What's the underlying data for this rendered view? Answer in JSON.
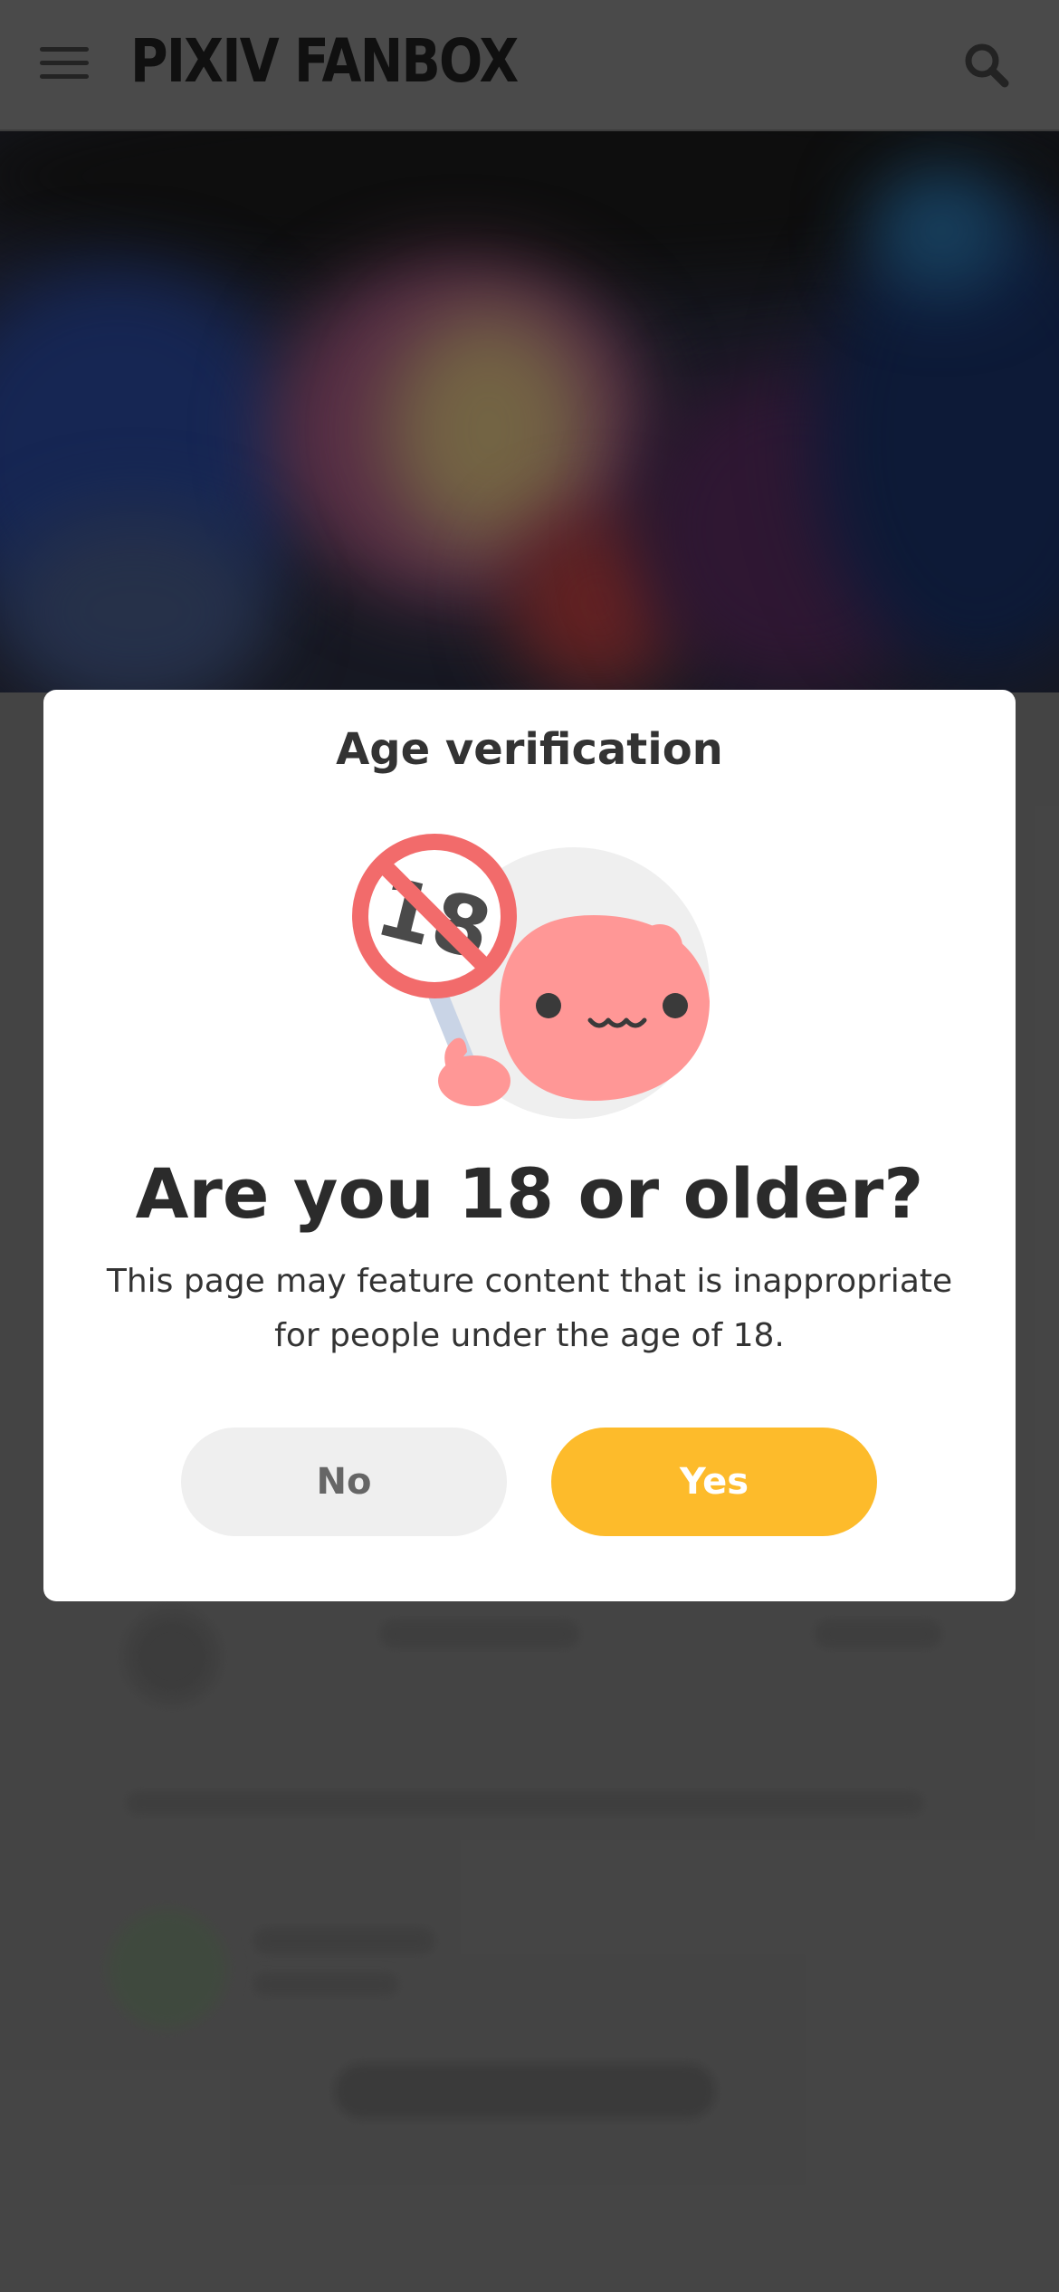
{
  "header": {
    "logo_text": "PIXIV FANBOX",
    "menu_icon": "hamburger-menu-icon",
    "search_icon": "search-icon"
  },
  "modal": {
    "title": "Age verification",
    "illustration": "pink-mascot-holding-no-18-sign",
    "question": "Are you 18 or older?",
    "description": "This page may feature content that is inappropriate for people under the age of 18.",
    "no_label": "No",
    "yes_label": "Yes"
  },
  "colors": {
    "accent_yellow": "#fdbb2b",
    "no_button_bg": "#efefef",
    "mascot_pink": "#ff9796",
    "warning_red": "#f26b6b",
    "text_dark": "#333333"
  }
}
